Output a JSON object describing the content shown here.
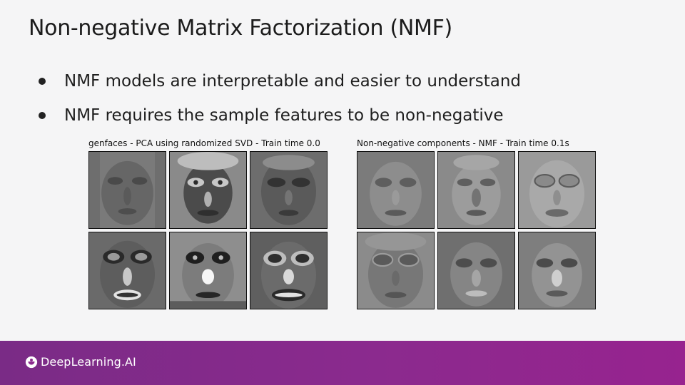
{
  "slide": {
    "title": "Non-negative Matrix Factorization (NMF)",
    "bullets": [
      "NMF models are interpretable and easier to understand",
      "NMF requires the sample features to be non-negative"
    ]
  },
  "figures": {
    "pca": {
      "caption": "genfaces - PCA using randomized SVD - Train time 0.0"
    },
    "nmf": {
      "caption": "Non-negative components - NMF - Train time 0.1s"
    }
  },
  "footer": {
    "brand": "DeepLearning.AI",
    "brand_icon": "deeplearning-ai-logo-icon"
  },
  "colors": {
    "footer_start": "#7a2b86",
    "footer_end": "#97238f",
    "slide_background": "#f5f5f6"
  }
}
